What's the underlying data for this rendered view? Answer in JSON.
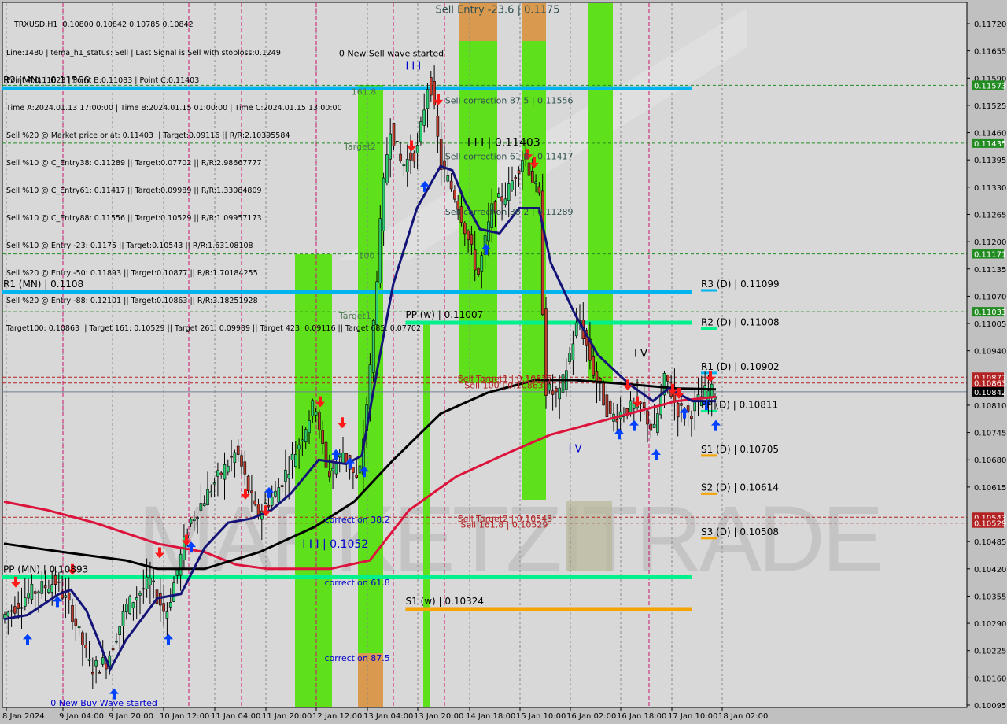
{
  "header": {
    "symbol_line": "TRXUSD,H1  0.10800 0.10842 0.10785 0.10842",
    "info_lines": [
      "Line:1480 | tema_h1_status: Sell | Last Signal is:Sell with stoploss:0.1249",
      "Point A:0.11623 | Point B:0.11083 | Point C:0.11403",
      "Time A:2024.01.13 17:00:00 | Time B:2024.01.15 01:00:00 | Time C:2024.01.15 13:00:00",
      "Sell %20 @ Market price or at: 0.11403 || Target:0.09116 || R/R:2.10395584",
      "Sell %10 @ C_Entry38: 0.11289 || Target:0.07702 || R/R:2.98667777",
      "Sell %10 @ C_Entry61: 0.11417 || Target:0.09989 || R/R:1.33084809",
      "Sell %10 @ C_Entry88: 0.11556 || Target:0.10529 || R/R:1.09957173",
      "Sell %10 @ Entry -23: 0.1175 || Target:0.10543 || R/R:1.63108108",
      "Sell %20 @ Entry -50: 0.11893 || Target:0.10877 || R/R:1.70184255",
      "Sell %20 @ Entry -88: 0.12101 || Target:0.10863 || R/R:3.18251928",
      "Target100: 0.10863 || Target 161: 0.10529 || Target 261: 0.09989 || Target 423: 0.09116 || Target 685: 0.07702"
    ]
  },
  "colors": {
    "background": "#d8d8d8",
    "axis_bg": "#c0c0c0",
    "bull": "#2ecc71",
    "bear": "#c0392b",
    "pivot_blue": "#00b4f0",
    "pivot_green": "#00f08c",
    "pivot_orange": "#f5a300",
    "zone_green": "#5ee01a",
    "zone_orange": "#d99a50",
    "ma_black": "#000000",
    "ma_red": "#dc143c",
    "ma_navy": "#141478",
    "tag_green": "#228b22",
    "tag_red": "#b22222"
  },
  "chart_data": {
    "type": "candlestick",
    "title": "TRXUSD,H1",
    "ylim": [
      0.1008,
      0.1176
    ],
    "x_ticks": [
      "8 Jan 2024",
      "9 Jan 04:00",
      "9 Jan 20:00",
      "10 Jan 12:00",
      "11 Jan 04:00",
      "11 Jan 20:00",
      "12 Jan 12:00",
      "13 Jan 04:00",
      "13 Jan 20:00",
      "14 Jan 18:00",
      "15 Jan 10:00",
      "16 Jan 02:00",
      "16 Jan 18:00",
      "17 Jan 10:00",
      "18 Jan 02:00"
    ],
    "y_ticks": [
      "0.11720",
      "0.11655",
      "0.11590",
      "0.11525",
      "0.11460",
      "0.11395",
      "0.11330",
      "0.11265",
      "0.11200",
      "0.11135",
      "0.11070",
      "0.11005",
      "0.10940",
      "0.10810",
      "0.10745",
      "0.10680",
      "0.10615",
      "0.10485",
      "0.10420",
      "0.10355",
      "0.10290",
      "0.10225",
      "0.10160",
      "0.10095"
    ],
    "price_tags": [
      {
        "value": "0.11573",
        "price": 0.11573,
        "kind": "green"
      },
      {
        "value": "0.11435",
        "price": 0.11435,
        "kind": "green"
      },
      {
        "value": "0.11171",
        "price": 0.11171,
        "kind": "green"
      },
      {
        "value": "0.11033",
        "price": 0.11033,
        "kind": "green"
      },
      {
        "value": "0.10877",
        "price": 0.10877,
        "kind": "red"
      },
      {
        "value": "0.10863",
        "price": 0.10863,
        "kind": "red"
      },
      {
        "value": "0.10842",
        "price": 0.10842,
        "kind": "black"
      },
      {
        "value": "0.10543",
        "price": 0.10543,
        "kind": "red"
      },
      {
        "value": "0.10529",
        "price": 0.10529,
        "kind": "red"
      }
    ],
    "horizontal_levels": [
      {
        "label": "R2 (MN) | 0.11566",
        "price": 0.11566,
        "kind": "blue-thick",
        "x0": 0,
        "x1": 0.715,
        "label_at": "left"
      },
      {
        "label": "R1 (MN) | 0.1108",
        "price": 0.1108,
        "kind": "blue-thick",
        "x0": 0,
        "x1": 0.715,
        "label_at": "left"
      },
      {
        "label": "PP (MN) | 0.10893",
        "price": 0.104,
        "kind": "green-thick",
        "x0": 0,
        "x1": 0.715,
        "label_at": "left"
      },
      {
        "label": "PP (w) | 0.11007",
        "price": 0.11007,
        "kind": "green-thick",
        "x0": 0.418,
        "x1": 0.715,
        "label_at": "start"
      },
      {
        "label": "S1 (w) | 0.10324",
        "price": 0.10324,
        "kind": "orange-thick",
        "x0": 0.418,
        "x1": 0.715,
        "label_at": "start"
      },
      {
        "label": "R3 (D) | 0.11099",
        "price": 0.11099,
        "kind": "blue-short",
        "label_at": "right"
      },
      {
        "label": "R2 (D) | 0.11008",
        "price": 0.11008,
        "kind": "green-short",
        "label_at": "right"
      },
      {
        "label": "R1 (D) | 0.10902",
        "price": 0.10902,
        "kind": "blue-short",
        "label_at": "right"
      },
      {
        "label": "PP (D) | 0.10811",
        "price": 0.10811,
        "kind": "green-short",
        "label_at": "right"
      },
      {
        "label": "S1 (D) | 0.10705",
        "price": 0.10705,
        "kind": "orange-short",
        "label_at": "right"
      },
      {
        "label": "S2 (D) | 0.10614",
        "price": 0.10614,
        "kind": "orange-short",
        "label_at": "right"
      },
      {
        "label": "S3 (D) | 0.10508",
        "price": 0.10508,
        "kind": "orange-short",
        "label_at": "right"
      }
    ],
    "dashed_levels": [
      0.11573,
      0.11435,
      0.11171,
      0.11033
    ],
    "red_dashed_levels": [
      0.10877,
      0.10863,
      0.10543,
      0.10529
    ],
    "annotations": [
      {
        "text": "Sell Entry -23.6 | 0.1175",
        "price": 0.11745,
        "x": 0.449,
        "color": "#2f4f4f",
        "size": 13
      },
      {
        "text": "0 New Sell wave started",
        "price": 0.11642,
        "x": 0.349,
        "color": "#000000",
        "size": 11
      },
      {
        "text": "I I I",
        "price": 0.1161,
        "x": 0.418,
        "color": "#0000cc",
        "size": 13
      },
      {
        "text": "Sell correction 87.5 | 0.11556",
        "price": 0.1153,
        "x": 0.459,
        "color": "#2f4f4f",
        "size": 11
      },
      {
        "text": "I I I | 0.11403",
        "price": 0.11428,
        "x": 0.482,
        "color": "#000000",
        "size": 14
      },
      {
        "text": "Sell correction 61.8 | 0.11417",
        "price": 0.11396,
        "x": 0.459,
        "color": "#2f4f4f",
        "size": 11
      },
      {
        "text": "Sell correction 38.2 | 0.11289",
        "price": 0.11264,
        "x": 0.459,
        "color": "#2f4f4f",
        "size": 11
      },
      {
        "text": "161.8",
        "price": 0.1155,
        "x": 0.362,
        "color": "#4a7a4a",
        "size": 11
      },
      {
        "text": "Target2",
        "price": 0.1142,
        "x": 0.354,
        "color": "#4a7a4a",
        "size": 11
      },
      {
        "text": "100",
        "price": 0.1116,
        "x": 0.369,
        "color": "#4a7a4a",
        "size": 11
      },
      {
        "text": "Target1",
        "price": 0.11016,
        "x": 0.349,
        "color": "#4a7a4a",
        "size": 11
      },
      {
        "text": "I V",
        "price": 0.10925,
        "x": 0.655,
        "color": "#000000",
        "size": 13
      },
      {
        "text": "I V",
        "price": 0.10698,
        "x": 0.587,
        "color": "#0000cc",
        "size": 13
      },
      {
        "text": "Sell Target1 | 0.10877",
        "price": 0.10866,
        "x": 0.472,
        "color": "#b22222",
        "size": 11
      },
      {
        "text": "Sell 100 | 0.10863",
        "price": 0.1085,
        "x": 0.479,
        "color": "#b22222",
        "size": 11
      },
      {
        "text": "Sell Target2 | 0.10543",
        "price": 0.10532,
        "x": 0.472,
        "color": "#b22222",
        "size": 11
      },
      {
        "text": "Sell 161.8 | 0.10529",
        "price": 0.10518,
        "x": 0.475,
        "color": "#b22222",
        "size": 11
      },
      {
        "text": "correction 38.2",
        "price": 0.1053,
        "x": 0.334,
        "color": "#0000cc",
        "size": 11
      },
      {
        "text": "I I I | 0.1052",
        "price": 0.1047,
        "x": 0.311,
        "color": "#0000cc",
        "size": 14
      },
      {
        "text": "correction 61.8",
        "price": 0.1038,
        "x": 0.334,
        "color": "#0000cc",
        "size": 11
      },
      {
        "text": "correction 87.5",
        "price": 0.102,
        "x": 0.334,
        "color": "#0000cc",
        "size": 11
      },
      {
        "text": "0 New Buy Wave started",
        "price": 0.10093,
        "x": 0.05,
        "color": "#0000cc",
        "size": 11
      }
    ],
    "watermark": "MARKETZITRADE"
  }
}
